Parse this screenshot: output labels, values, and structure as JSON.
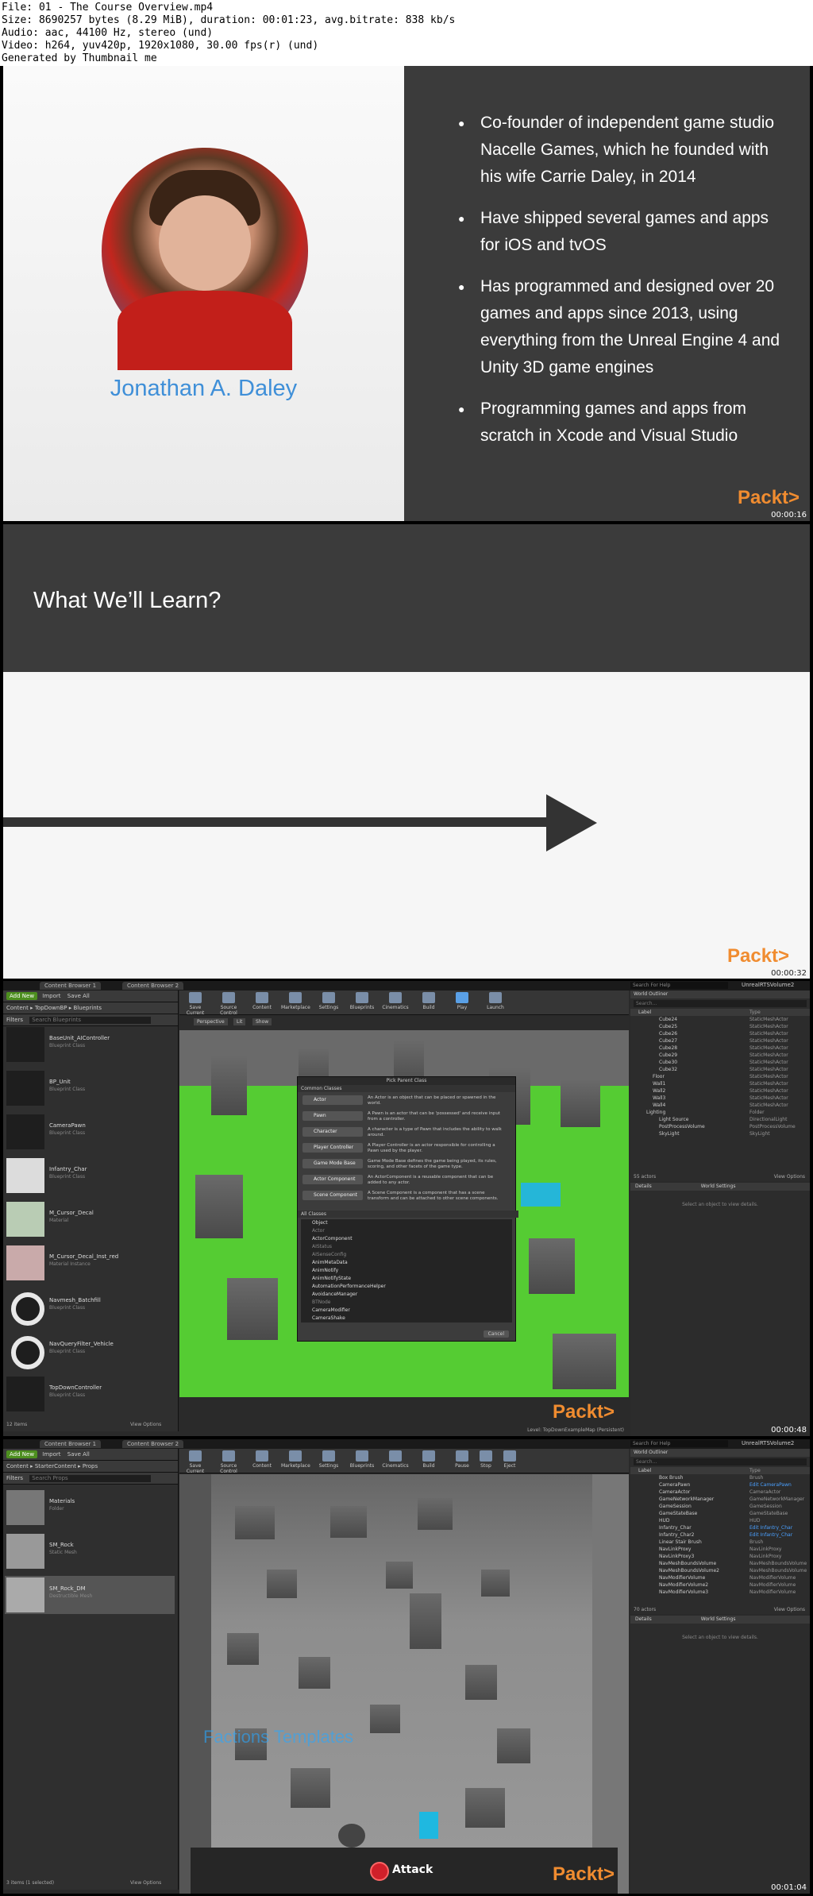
{
  "header": {
    "lines": [
      "File: 01 - The Course Overview.mp4",
      "Size: 8690257 bytes (8.29 MiB), duration: 00:01:23, avg.bitrate: 838 kb/s",
      "Audio: aac, 44100 Hz, stereo (und)",
      "Video: h264, yuv420p, 1920x1080, 30.00 fps(r) (und)",
      "Generated by Thumbnail me"
    ]
  },
  "frame1": {
    "name": "Jonathan A. Daley",
    "bullets": [
      "Co-founder of independent game studio Nacelle Games, which he founded with his wife Carrie Daley, in 2014",
      "Have shipped several games and apps for iOS and tvOS",
      "Has programmed and designed over 20 games and apps since 2013, using everything from the Unreal Engine 4 and Unity 3D game engines",
      "Programming games and apps from scratch in Xcode and Visual Studio"
    ],
    "logo": "Packt>",
    "timestamp": "00:00:16"
  },
  "frame2": {
    "title": "What We’ll Learn?",
    "logo": "Packt>",
    "timestamp": "00:00:32"
  },
  "frame3": {
    "tabs": [
      "Content Browser 1",
      "Content Browser 2"
    ],
    "add_new": "Add New",
    "import": "Import",
    "save_all": "Save All",
    "path": [
      "Content",
      "TopDownBP",
      "Blueprints"
    ],
    "filters": "Filters",
    "search_placeholder": "Search Blueprints",
    "assets": [
      {
        "name": "BaseUnit_AIController",
        "type": "Blueprint Class"
      },
      {
        "name": "BP_Unit",
        "type": "Blueprint Class"
      },
      {
        "name": "CameraPawn",
        "type": "Blueprint Class"
      },
      {
        "name": "Infantry_Char",
        "type": "Blueprint Class"
      },
      {
        "name": "M_Cursor_Decal",
        "type": "Material"
      },
      {
        "name": "M_Cursor_Decal_Inst_red",
        "type": "Material Instance"
      },
      {
        "name": "Navmesh_Batchfill",
        "type": "Blueprint Class"
      },
      {
        "name": "NavQueryFilter_Vehicle",
        "type": "Blueprint Class"
      },
      {
        "name": "TopDownController",
        "type": "Blueprint Class"
      }
    ],
    "items_count": "12 items",
    "view_options": "View Options",
    "toolbar": [
      "Save Current",
      "Source Control",
      "Content",
      "Marketplace",
      "Settings",
      "Blueprints",
      "Cinematics",
      "Build",
      "Play",
      "Launch"
    ],
    "viewport_labels": [
      "Perspective",
      "Lit",
      "Show"
    ],
    "dialog": {
      "title": "Pick Parent Class",
      "common": "Common Classes",
      "options": [
        {
          "label": "Actor",
          "desc": "An Actor is an object that can be placed or spawned in the world."
        },
        {
          "label": "Pawn",
          "desc": "A Pawn is an actor that can be 'possessed' and receive input from a controller."
        },
        {
          "label": "Character",
          "desc": "A character is a type of Pawn that includes the ability to walk around."
        },
        {
          "label": "Player Controller",
          "desc": "A Player Controller is an actor responsible for controlling a Pawn used by the player."
        },
        {
          "label": "Game Mode Base",
          "desc": "Game Mode Base defines the game being played, its rules, scoring, and other facets of the game type."
        },
        {
          "label": "Actor Component",
          "desc": "An ActorComponent is a reusable component that can be added to any actor."
        },
        {
          "label": "Scene Component",
          "desc": "A Scene Component is a component that has a scene transform and can be attached to other scene components."
        }
      ],
      "all": "All Classes",
      "classes": [
        "Object",
        "Actor",
        "ActorComponent",
        "AIStatus",
        "AISenseConfig",
        "AnimMetaData",
        "AnimNotify",
        "AnimNotifyState",
        "AutomationPerformanceHelper",
        "AvoidanceManager",
        "BTNode",
        "CameraModifier",
        "CameraShake",
        "CheatManager"
      ],
      "cancel": "Cancel"
    },
    "outliner_title": "World Outliner",
    "outliner_search": "Search...",
    "outliner_header": {
      "label": "Label",
      "type": "Type"
    },
    "outliner_rows": [
      {
        "label": "Cube24",
        "type": "StaticMeshActor"
      },
      {
        "label": "Cube25",
        "type": "StaticMeshActor"
      },
      {
        "label": "Cube26",
        "type": "StaticMeshActor"
      },
      {
        "label": "Cube27",
        "type": "StaticMeshActor"
      },
      {
        "label": "Cube28",
        "type": "StaticMeshActor"
      },
      {
        "label": "Cube29",
        "type": "StaticMeshActor"
      },
      {
        "label": "Cube30",
        "type": "StaticMeshActor"
      },
      {
        "label": "Cube32",
        "type": "StaticMeshActor"
      },
      {
        "label": "Floor",
        "type": "StaticMeshActor"
      },
      {
        "label": "Wall1",
        "type": "StaticMeshActor"
      },
      {
        "label": "Wall2",
        "type": "StaticMeshActor"
      },
      {
        "label": "Wall3",
        "type": "StaticMeshActor"
      },
      {
        "label": "Wall4",
        "type": "StaticMeshActor"
      },
      {
        "label": "Lighting",
        "type": "Folder"
      },
      {
        "label": "Light Source",
        "type": "DirectionalLight"
      },
      {
        "label": "PostProcessVolume",
        "type": "PostProcessVolume"
      },
      {
        "label": "SkyLight",
        "type": "SkyLight"
      }
    ],
    "actors_count": "55 actors",
    "details_title": "Details",
    "world_settings": "World Settings",
    "details_hint": "Select an object to view details.",
    "level": "Level: TopDownExampleMap (Persistent)",
    "search_help": "Search For Help",
    "project": "UnrealRTSVolume2",
    "logo": "Packt>",
    "timestamp": "00:00:48"
  },
  "frame4": {
    "tabs": [
      "Content Browser 1",
      "Content Browser 2"
    ],
    "add_new": "Add New",
    "import": "Import",
    "save_all": "Save All",
    "path": [
      "Content",
      "StarterContent",
      "Props"
    ],
    "filters": "Filters",
    "search_placeholder": "Search Props",
    "assets": [
      {
        "name": "Materials",
        "type": "Folder"
      },
      {
        "name": "SM_Rock",
        "type": "Static Mesh"
      },
      {
        "name": "SM_Rock_DM",
        "type": "Destructible Mesh"
      }
    ],
    "items_count": "3 items (1 selected)",
    "view_options": "View Options",
    "toolbar": [
      "Save Current",
      "Source Control",
      "Content",
      "Marketplace",
      "Settings",
      "Blueprints",
      "Cinematics",
      "Build",
      "Pause",
      "Stop",
      "Eject"
    ],
    "viewport_text": "Factions Templates",
    "attack": "Attack",
    "outliner_title": "World Outliner",
    "outliner_search": "Search...",
    "outliner_header": {
      "label": "Label",
      "type": "Type"
    },
    "outliner_rows": [
      {
        "label": "Box Brush",
        "type": "Brush"
      },
      {
        "label": "CameraPawn",
        "type": "Edit CameraPawn"
      },
      {
        "label": "CameraActor",
        "type": "CameraActor"
      },
      {
        "label": "GameNetworkManager",
        "type": "GameNetworkManager"
      },
      {
        "label": "GameSession",
        "type": "GameSession"
      },
      {
        "label": "GameStateBase",
        "type": "GameStateBase"
      },
      {
        "label": "HUD",
        "type": "HUD"
      },
      {
        "label": "Infantry_Char",
        "type": "Edit Infantry_Char"
      },
      {
        "label": "Infantry_Char2",
        "type": "Edit Infantry_Char"
      },
      {
        "label": "Linear Stair Brush",
        "type": "Brush"
      },
      {
        "label": "NavLinkProxy",
        "type": "NavLinkProxy"
      },
      {
        "label": "NavLinkProxy3",
        "type": "NavLinkProxy"
      },
      {
        "label": "NavMeshBoundsVolume",
        "type": "NavMeshBoundsVolume"
      },
      {
        "label": "NavMeshBoundsVolume2",
        "type": "NavMeshBoundsVolume"
      },
      {
        "label": "NavModifierVolume",
        "type": "NavModifierVolume"
      },
      {
        "label": "NavModifierVolume2",
        "type": "NavModifierVolume"
      },
      {
        "label": "NavModifierVolume3",
        "type": "NavModifierVolume"
      }
    ],
    "actors_count": "70 actors",
    "details_title": "Details",
    "world_settings": "World Settings",
    "details_hint": "Select an object to view details.",
    "search_help": "Search For Help",
    "project": "UnrealRTSVolume2",
    "logo": "Packt>",
    "timestamp": "00:01:04"
  }
}
